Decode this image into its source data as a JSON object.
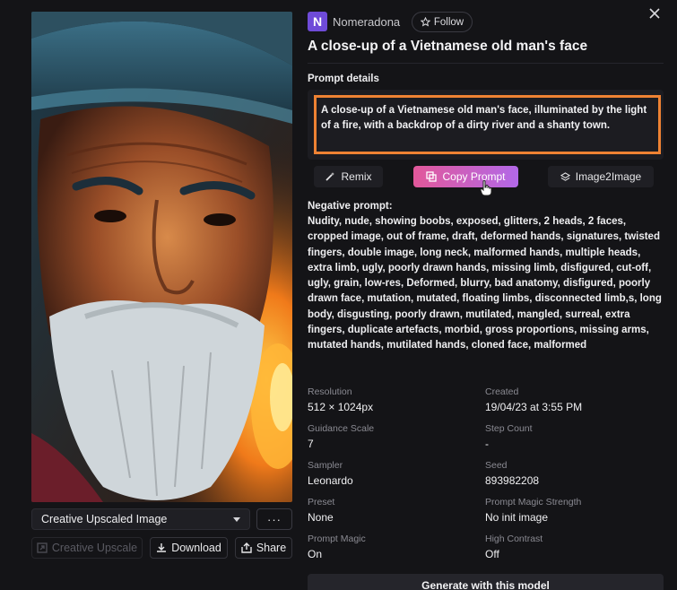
{
  "image": {
    "alt": "Portrait of an elderly man with a white beard wearing a hat, lit by fire"
  },
  "variant_select": {
    "value": "Creative Upscaled Image"
  },
  "more_button": {
    "label": "···"
  },
  "actions": {
    "upscale_label": "Creative Upscale",
    "download_label": "Download",
    "share_label": "Share"
  },
  "author": {
    "avatar_letter": "N",
    "name": "Nomeradona",
    "follow_label": "Follow"
  },
  "close_icon": "close-icon",
  "title": "A close-up of a Vietnamese old man's face",
  "prompt_details": {
    "label": "Prompt details",
    "text": "A close-up of a Vietnamese old man's face, illuminated by the light of a fire, with a backdrop of a dirty river and a shanty town."
  },
  "tools": {
    "remix_label": "Remix",
    "copy_label": "Copy Prompt",
    "img2img_label": "Image2Image"
  },
  "negative_prompt": {
    "label": "Negative prompt:",
    "text": "Nudity, nude, showing boobs, exposed, glitters, 2 heads, 2 faces, cropped image, out of frame, draft, deformed hands, signatures, twisted fingers, double image, long neck, malformed hands, multiple heads, extra limb, ugly, poorly drawn hands, missing limb, disfigured, cut-off, ugly, grain, low-res, Deformed, blurry, bad anatomy, disfigured, poorly drawn face, mutation, mutated, floating limbs, disconnected limb,s, long body, disgusting, poorly drawn, mutilated, mangled, surreal, extra fingers, duplicate artefacts, morbid, gross proportions, missing arms, mutated hands, mutilated hands, cloned face, malformed"
  },
  "meta": {
    "resolution": {
      "label": "Resolution",
      "value": "512 × 1024px"
    },
    "created": {
      "label": "Created",
      "value": "19/04/23 at 3:55 PM"
    },
    "guidance": {
      "label": "Guidance Scale",
      "value": "7"
    },
    "steps": {
      "label": "Step Count",
      "value": "-"
    },
    "sampler": {
      "label": "Sampler",
      "value": "Leonardo"
    },
    "seed": {
      "label": "Seed",
      "value": "893982208"
    },
    "preset": {
      "label": "Preset",
      "value": "None"
    },
    "magic_strength": {
      "label": "Prompt Magic Strength",
      "value": "No init image"
    },
    "prompt_magic": {
      "label": "Prompt Magic",
      "value": "On"
    },
    "high_contrast": {
      "label": "High Contrast",
      "value": "Off"
    }
  },
  "generate": {
    "label": "Generate with this model"
  },
  "colors": {
    "accent_highlight": "#ee8233",
    "copy_gradient_start": "#e2589a",
    "copy_gradient_end": "#b268e8",
    "avatar": "#6f4bd8"
  }
}
